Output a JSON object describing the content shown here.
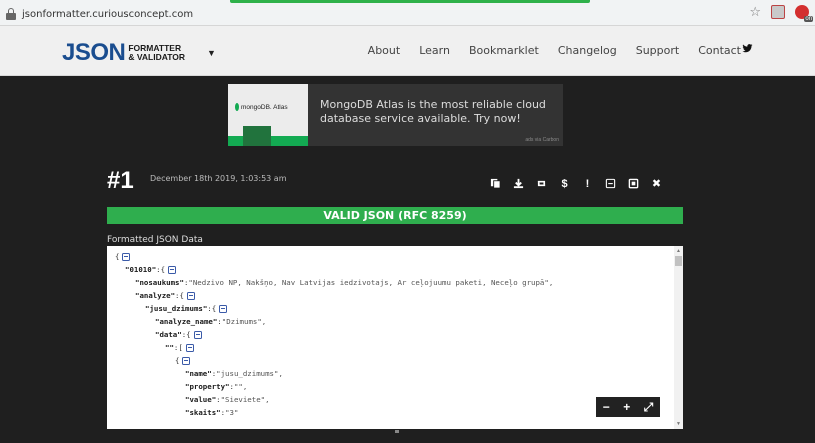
{
  "browser": {
    "url": "jsonformatter.curiousconcept.com"
  },
  "navbar": {
    "logo_main": "JSON",
    "logo_sub_1": "FORMATTER",
    "logo_sub_2": "& VALIDATOR",
    "links": [
      "About",
      "Learn",
      "Bookmarklet",
      "Changelog",
      "Support",
      "Contact"
    ]
  },
  "ad": {
    "brand": "mongoDB. Atlas",
    "text": "MongoDB Atlas is the most reliable cloud database service available. Try now!",
    "via": "ads via Carbon"
  },
  "result": {
    "number": "#1",
    "date": "December 18th 2019, 1:03:53 am",
    "status": "VALID JSON (RFC 8259)",
    "formatted_label": "Formatted JSON Data",
    "toolbar_icons": [
      "copy-icon",
      "download-icon",
      "retweet-icon",
      "dollar-icon",
      "exclamation-icon",
      "collapse-icon",
      "expand-icon",
      "close-icon"
    ]
  },
  "json_lines": [
    {
      "indent": 0,
      "key": "",
      "value": "{",
      "collapse": true
    },
    {
      "indent": 1,
      "key": "\"01010\"",
      "sep": ":",
      "value": "{",
      "collapse": true
    },
    {
      "indent": 2,
      "key": "\"nosaukums\"",
      "sep": ":",
      "value": "\"Nedzivo NP, Nakšņo, Nav Latvijas iedzivotajs, Ar ceļojuumu paketi, Neceļo grupā\",",
      "collapse": false
    },
    {
      "indent": 2,
      "key": "\"analyze\"",
      "sep": ":",
      "value": "{",
      "collapse": true
    },
    {
      "indent": 3,
      "key": "\"jusu_dzimums\"",
      "sep": ":",
      "value": "{",
      "collapse": true
    },
    {
      "indent": 4,
      "key": "\"analyze_name\"",
      "sep": ":",
      "value": "\"Dzimums\",",
      "collapse": false
    },
    {
      "indent": 4,
      "key": "\"data\"",
      "sep": ":",
      "value": "{",
      "collapse": true
    },
    {
      "indent": 5,
      "key": "\"\"",
      "sep": ":",
      "value": "[",
      "collapse": true
    },
    {
      "indent": 6,
      "key": "",
      "value": "{",
      "collapse": true
    },
    {
      "indent": 7,
      "key": "\"name\"",
      "sep": ":",
      "value": "\"jusu_dzimums\",",
      "collapse": false
    },
    {
      "indent": 7,
      "key": "\"property\"",
      "sep": ":",
      "value": "\"\",",
      "collapse": false
    },
    {
      "indent": 7,
      "key": "\"value\"",
      "sep": ":",
      "value": "\"Sieviete\",",
      "collapse": false
    },
    {
      "indent": 7,
      "key": "\"skaits\"",
      "sep": ":",
      "value": "\"3\"",
      "collapse": false
    }
  ],
  "zoom": {
    "minus": "−",
    "plus": "+",
    "fullscreen": "⤢"
  }
}
